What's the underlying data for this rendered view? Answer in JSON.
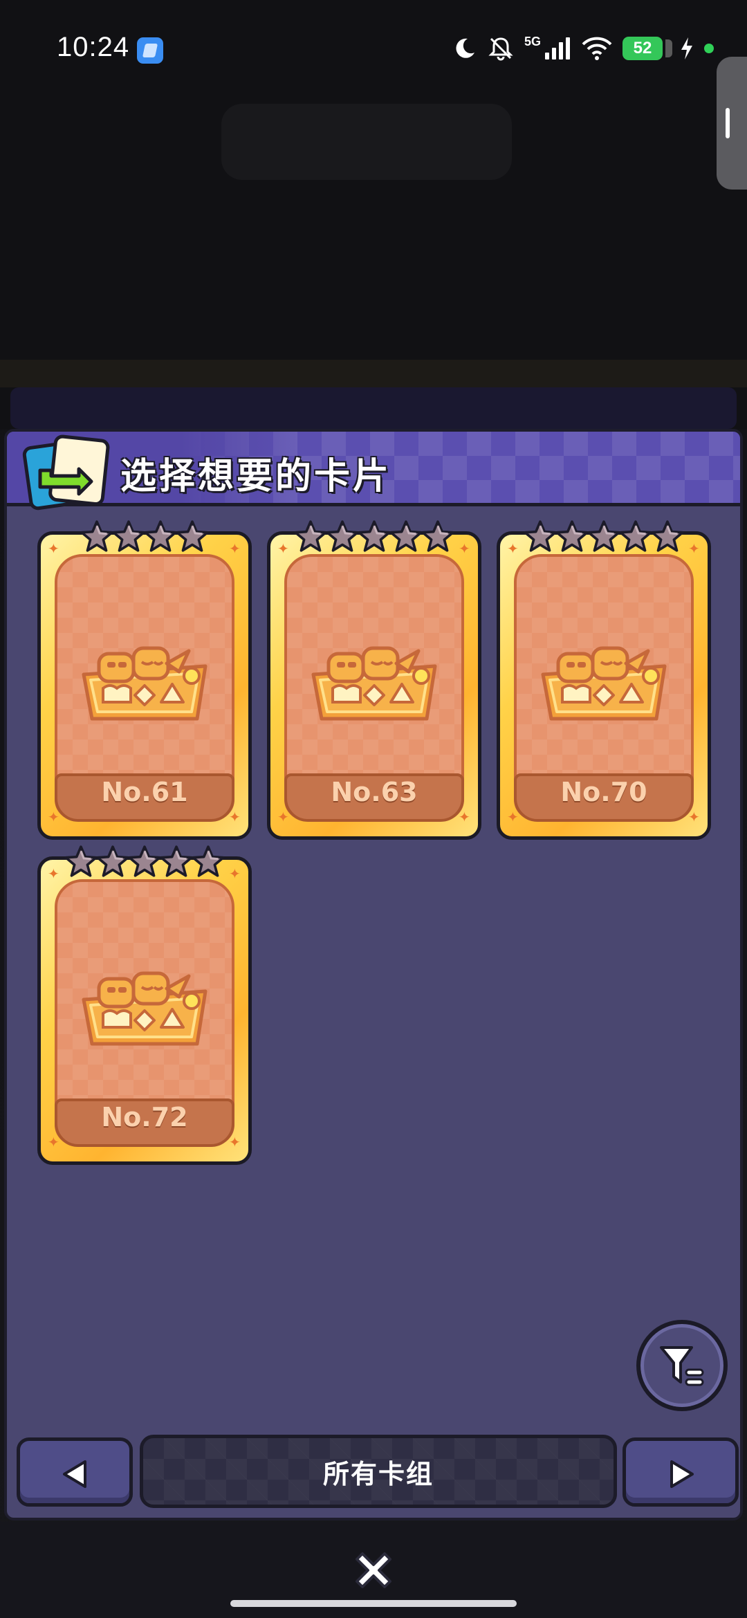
{
  "status_bar": {
    "time": "10:24",
    "network": "5G",
    "battery": "52"
  },
  "panel": {
    "title": "选择想要的卡片"
  },
  "cards": [
    {
      "label": "No.61",
      "stars": 4
    },
    {
      "label": "No.63",
      "stars": 5
    },
    {
      "label": "No.70",
      "stars": 5
    },
    {
      "label": "No.72",
      "stars": 5
    }
  ],
  "nav": {
    "deck_label": "所有卡组"
  },
  "colors": {
    "panel_bg": "#4a4770",
    "header_bg": "#5b4fb0",
    "card_gold": "#ffd248",
    "card_inner": "#e7946e",
    "battery_green": "#34c759"
  },
  "icons": [
    "deck-swap-icon",
    "star-icon",
    "card-emblem-icon",
    "filter-icon",
    "arrow-left-icon",
    "arrow-right-icon",
    "close-icon"
  ]
}
